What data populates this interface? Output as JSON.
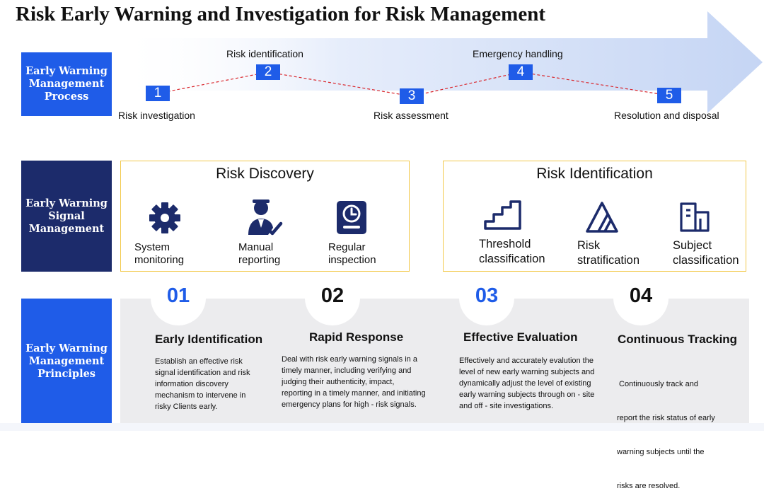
{
  "title": "Risk Early Warning and Investigation for Risk Management",
  "colors": {
    "bright_blue": "#1f5ce8",
    "navy": "#1c2b6b",
    "gold": "#f2c94c",
    "light_gray": "#ececee"
  },
  "sections": [
    {
      "label_lines": [
        "Early Warning",
        "Management",
        "Process"
      ],
      "color": "#1f5ce8"
    },
    {
      "label_lines": [
        "Early Warning",
        "Signal",
        "Management"
      ],
      "color": "#1c2b6b"
    },
    {
      "label_lines": [
        "Early Warning",
        "Management",
        "Principles"
      ],
      "color": "#1f5ce8"
    }
  ],
  "process_steps": [
    {
      "number": "1",
      "label": "Risk investigation"
    },
    {
      "number": "2",
      "label": "Risk identification"
    },
    {
      "number": "3",
      "label": "Risk assessment"
    },
    {
      "number": "4",
      "label": "Emergency handling"
    },
    {
      "number": "5",
      "label": "Resolution and disposal"
    }
  ],
  "risk_discovery": {
    "title": "Risk Discovery",
    "items": [
      {
        "icon": "gear-icon",
        "lines": [
          "System",
          "monitoring"
        ]
      },
      {
        "icon": "person-check-icon",
        "lines": [
          "Manual",
          "reporting"
        ]
      },
      {
        "icon": "clock-clipboard-icon",
        "lines": [
          "Regular",
          "inspection"
        ]
      }
    ]
  },
  "risk_identification": {
    "title": "Risk Identification",
    "items": [
      {
        "icon": "stairs-icon",
        "lines": [
          "Threshold",
          "classification"
        ]
      },
      {
        "icon": "triangle-layers-icon",
        "lines": [
          "Risk",
          "stratification"
        ]
      },
      {
        "icon": "building-icon",
        "lines": [
          "Subject",
          "classification"
        ]
      }
    ]
  },
  "principles": [
    {
      "number": "01",
      "color": "#1f5ce8",
      "title": "Early Identification",
      "lines": [
        "Establish an effective risk",
        "signal identification and risk",
        "information discovery",
        "mechanism to intervene in",
        "risky Clients early."
      ]
    },
    {
      "number": "02",
      "color": "#111111",
      "title": "Rapid Response",
      "lines": [
        "Deal with risk early warning signals in a",
        "timely manner, including verifying and",
        "judging their authenticity, impact,",
        "reporting in a timely manner, and initiating",
        "emergency plans for high - risk signals."
      ]
    },
    {
      "number": "03",
      "color": "#1f5ce8",
      "title": "Effective Evaluation",
      "lines": [
        "Effectively and accurately evalution the",
        "level of new early warning subjects and",
        "dynamically adjust the level of existing",
        "early warning subjects through on - site",
        "and off - site investigations."
      ]
    },
    {
      "number": "04",
      "color": "#111111",
      "title": "Continuous Tracking",
      "lines": [
        " Continuously track and",
        "report the risk status of early",
        "warning subjects until the",
        "risks are resolved."
      ]
    }
  ]
}
